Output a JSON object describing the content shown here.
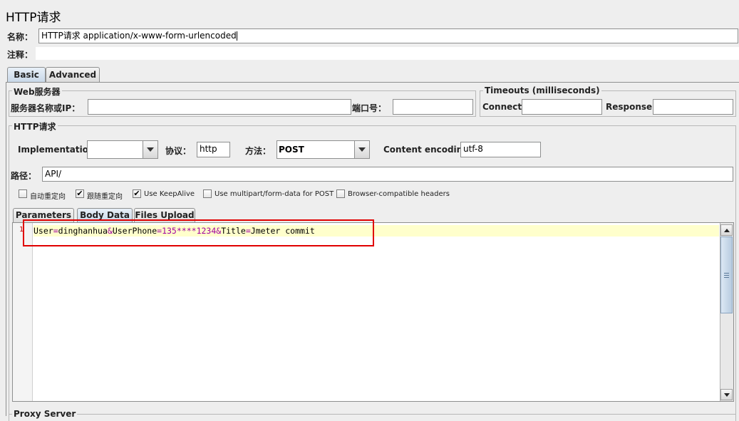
{
  "header": {
    "title": "HTTP请求"
  },
  "form": {
    "name_label": "名称：",
    "name_value": "HTTP请求  application/x-www-form-urlencoded",
    "comment_label": "注释："
  },
  "tabs": [
    {
      "label": "Basic",
      "selected": true
    },
    {
      "label": "Advanced",
      "selected": false
    }
  ],
  "web_server": {
    "legend": "Web服务器",
    "server_label": "服务器名称或IP：",
    "server_value": "",
    "port_label": "端口号：",
    "port_value": ""
  },
  "timeouts": {
    "legend": "Timeouts (milliseconds)",
    "connect_label": "Connect:",
    "connect_value": "",
    "response_label": "Response:",
    "response_value": ""
  },
  "http_request": {
    "legend": "HTTP请求",
    "implementation_label": "Implementation:",
    "implementation_value": "",
    "protocol_label": "协议：",
    "protocol_value": "http",
    "method_label": "方法：",
    "method_value": "POST",
    "encoding_label": "Content encoding:",
    "encoding_value": "utf-8",
    "path_label": "路径：",
    "path_value": "API/"
  },
  "options": [
    {
      "label": "自动重定向",
      "checked": false
    },
    {
      "label": "跟随重定向",
      "checked": true
    },
    {
      "label": "Use KeepAlive",
      "checked": true
    },
    {
      "label": "Use multipart/form-data for POST",
      "checked": false
    },
    {
      "label": "Browser-compatible headers",
      "checked": false
    }
  ],
  "subtabs": [
    {
      "label": "Parameters",
      "selected": false
    },
    {
      "label": "Body Data",
      "selected": true
    },
    {
      "label": "Files Upload",
      "selected": false
    }
  ],
  "editor": {
    "line_number": "1",
    "body": {
      "k1": "User",
      "eq1": "=",
      "v1": "dinghanhua",
      "amp1": "&",
      "k2": "UserPhone",
      "eq2": "=",
      "v2a": "135",
      "v2b": "****",
      "v2c": "1234",
      "amp2": "&",
      "k3": "Title",
      "eq3": "=",
      "v3": "Jmeter commit"
    }
  },
  "proxy": {
    "legend": "Proxy Server"
  },
  "colors": {
    "highlight_line": "#ffffcc",
    "number_color": "#a000a0",
    "annotation_box": "#e00000",
    "selected_tab": "#c8d8e8"
  }
}
